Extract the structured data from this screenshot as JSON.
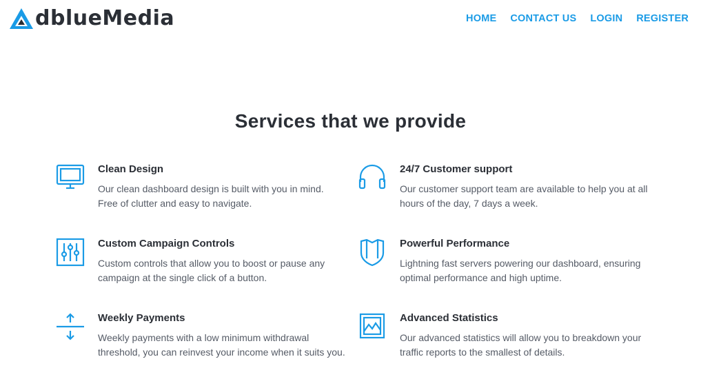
{
  "header": {
    "logo_text": "dblueMedia",
    "logo_icon": "logo-a-triangle-icon",
    "nav": [
      {
        "label": "HOME"
      },
      {
        "label": "CONTACT US"
      },
      {
        "label": "LOGIN"
      },
      {
        "label": "REGISTER"
      }
    ]
  },
  "main": {
    "title": "Services that we provide",
    "services": [
      {
        "icon": "monitor-icon",
        "title": "Clean Design",
        "description": "Our clean dashboard design is built with you in mind. Free of clutter and easy to navigate."
      },
      {
        "icon": "headphones-icon",
        "title": "24/7 Customer support",
        "description": "Our customer support team are available to help you at all hours of the day, 7 days a week."
      },
      {
        "icon": "sliders-icon",
        "title": "Custom Campaign Controls",
        "description": "Custom controls that allow you to boost or pause any campaign at the single click of a button."
      },
      {
        "icon": "shield-icon",
        "title": "Powerful Performance",
        "description": "Lightning fast servers powering our dashboard, ensuring optimal performance and high uptime."
      },
      {
        "icon": "up-down-arrows-icon",
        "title": "Weekly Payments",
        "description": "Weekly payments with a low minimum withdrawal threshold, you can reinvest your income when it suits you."
      },
      {
        "icon": "image-chart-icon",
        "title": "Advanced Statistics",
        "description": "Our advanced statistics will allow you to breakdown your traffic reports to the smallest of details."
      }
    ]
  },
  "colors": {
    "accent": "#1a9be6",
    "heading": "#2b2f36",
    "text": "#555b66"
  }
}
